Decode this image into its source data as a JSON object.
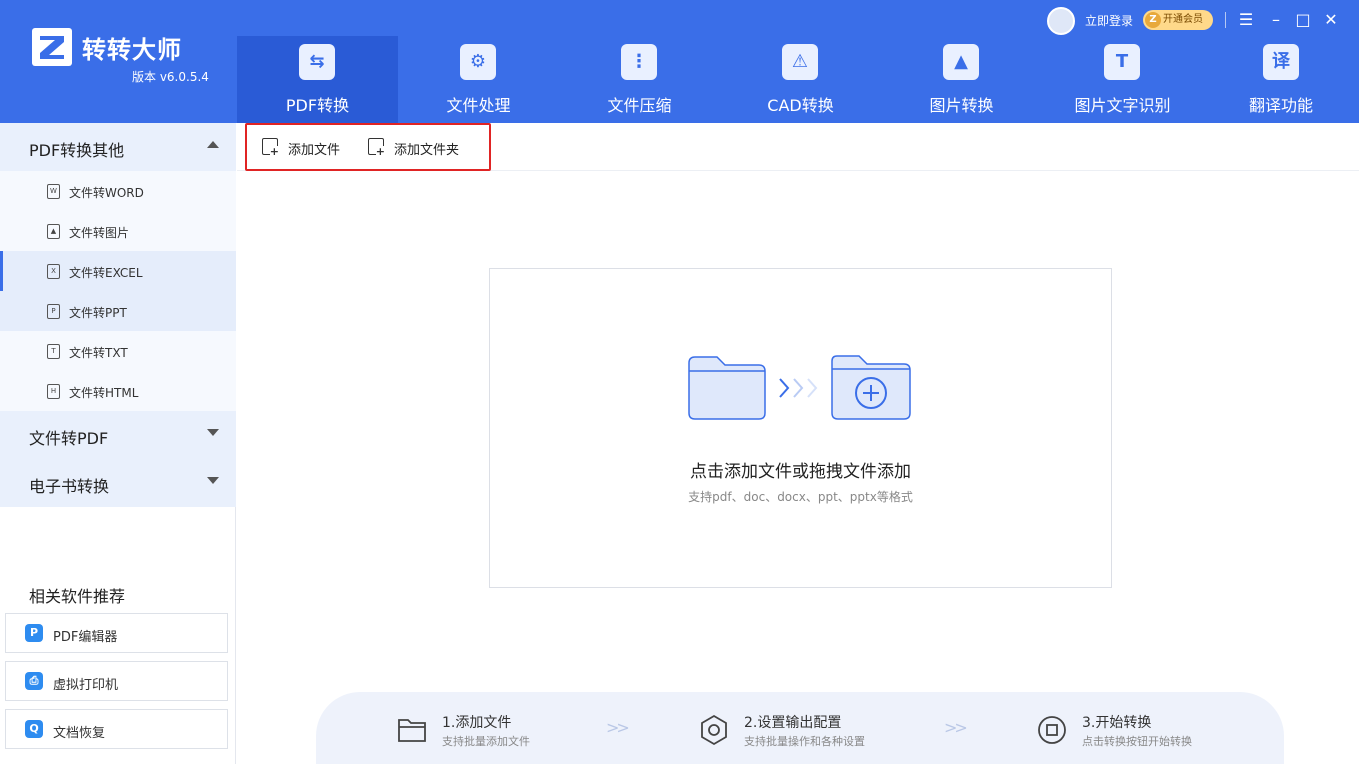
{
  "app": {
    "name": "转转大师",
    "version": "版本 v6.0.5.4"
  },
  "nav": {
    "tabs": [
      {
        "label": "PDF转换",
        "icon": "pdf-convert-icon",
        "active": true
      },
      {
        "label": "文件处理",
        "icon": "file-process-icon"
      },
      {
        "label": "文件压缩",
        "icon": "file-compress-icon"
      },
      {
        "label": "CAD转换",
        "icon": "cad-convert-icon"
      },
      {
        "label": "图片转换",
        "icon": "image-convert-icon"
      },
      {
        "label": "图片文字识别",
        "icon": "ocr-icon"
      },
      {
        "label": "翻译功能",
        "icon": "translate-icon"
      }
    ]
  },
  "account": {
    "login_text": "立即登录",
    "vip_text": "开通会员"
  },
  "sidebar": {
    "groups": [
      {
        "label": "PDF转换其他",
        "expanded": true,
        "items": [
          {
            "label": "文件转WORD",
            "icon_glyph": "W"
          },
          {
            "label": "文件转图片",
            "icon_glyph": "▲"
          },
          {
            "label": "文件转EXCEL",
            "icon_glyph": "X",
            "active": true
          },
          {
            "label": "文件转PPT",
            "icon_glyph": "P"
          },
          {
            "label": "文件转TXT",
            "icon_glyph": "T"
          },
          {
            "label": "文件转HTML",
            "icon_glyph": "H"
          }
        ]
      },
      {
        "label": "文件转PDF",
        "expanded": false
      },
      {
        "label": "电子书转换",
        "expanded": false
      }
    ],
    "recommend": {
      "title": "相关软件推荐",
      "items": [
        {
          "label": "PDF编辑器",
          "icon_glyph": "P"
        },
        {
          "label": "虚拟打印机",
          "icon_glyph": "⎙"
        },
        {
          "label": "文档恢复",
          "icon_glyph": "Q"
        }
      ]
    }
  },
  "toolbar": {
    "add_file": "添加文件",
    "add_folder": "添加文件夹"
  },
  "dropzone": {
    "title": "点击添加文件或拖拽文件添加",
    "subtitle": "支持pdf、doc、docx、ppt、pptx等格式"
  },
  "steps": [
    {
      "title": "1.添加文件",
      "desc": "支持批量添加文件"
    },
    {
      "title": "2.设置输出配置",
      "desc": "支持批量操作和各种设置"
    },
    {
      "title": "3.开始转换",
      "desc": "点击转换按钮开始转换"
    }
  ],
  "colors": {
    "brand_blue": "#3a6ee8",
    "active_tab": "#2a5bd6",
    "highlight_red": "#e02424"
  }
}
